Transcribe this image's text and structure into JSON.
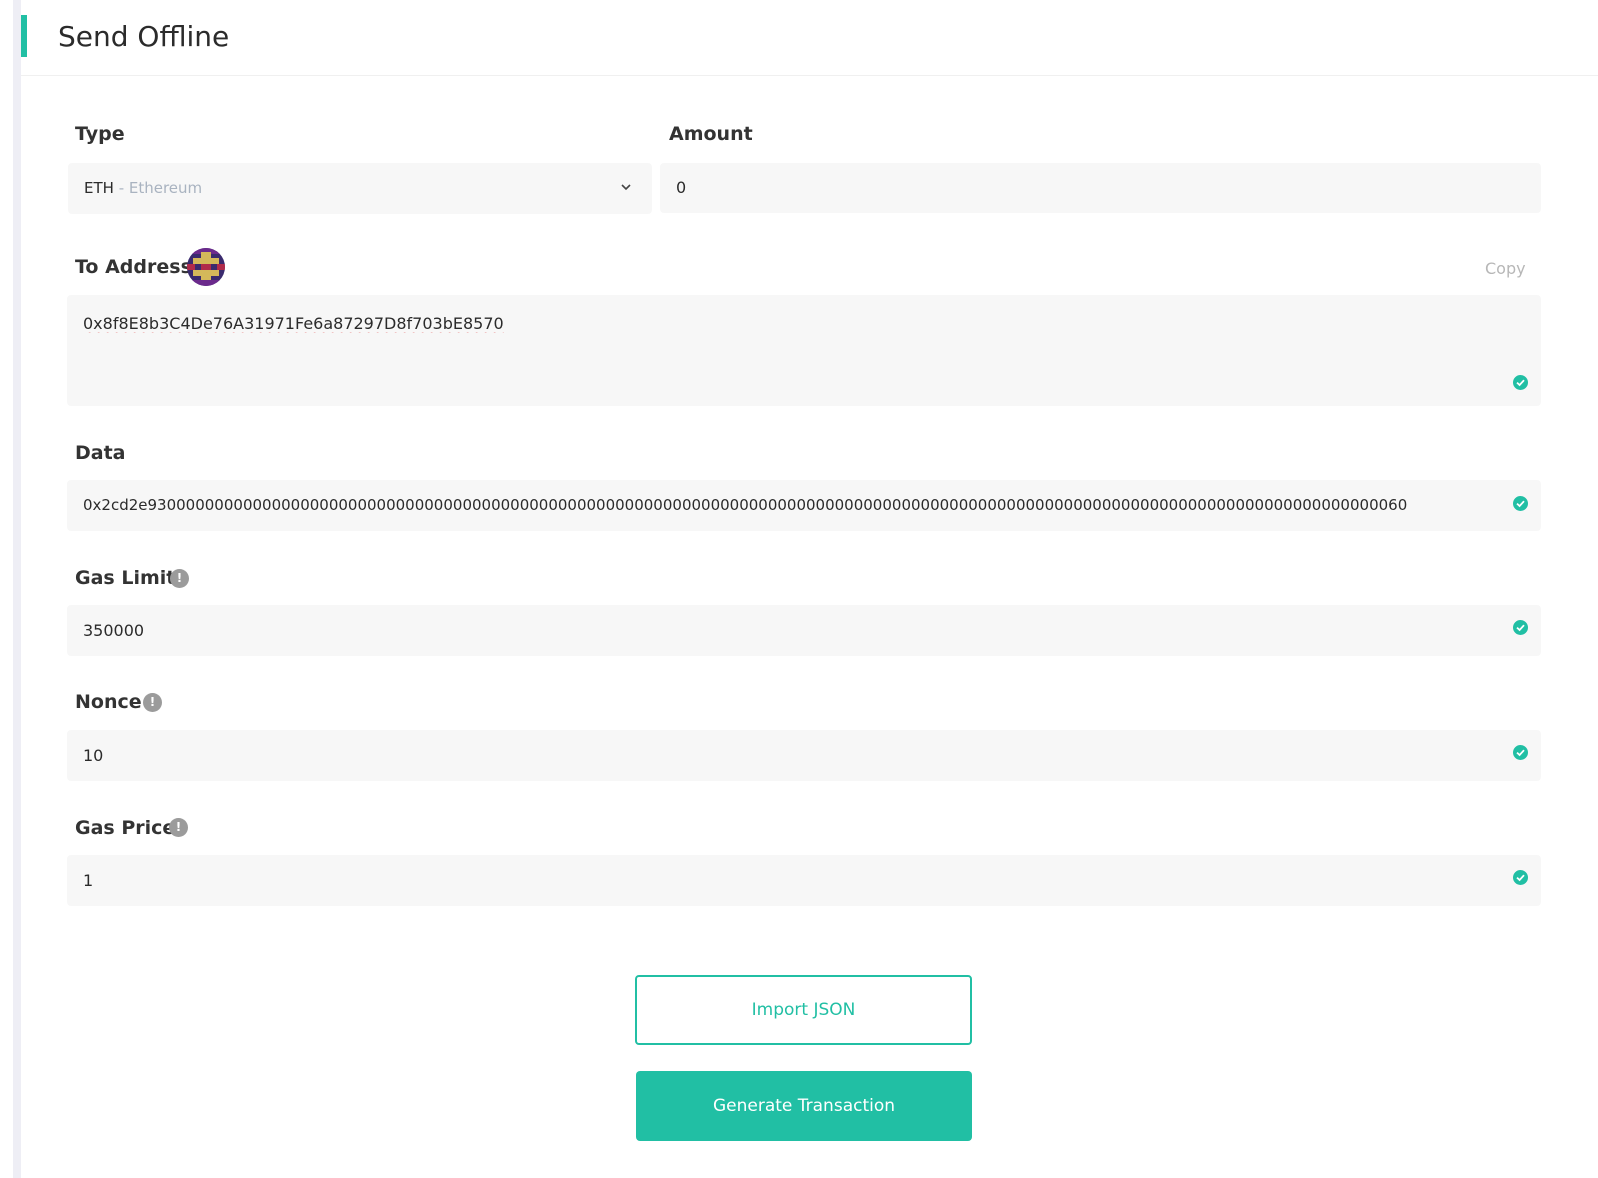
{
  "header": {
    "title": "Send Offline"
  },
  "type_field": {
    "label": "Type",
    "symbol": "ETH",
    "name": " - Ethereum"
  },
  "amount_field": {
    "label": "Amount",
    "value": "0"
  },
  "to_address": {
    "label": "To Address",
    "copy_label": "Copy",
    "value": "0x8f8E8b3C4De76A31971Fe6a87297D8f703bE8570"
  },
  "data_field": {
    "label": "Data",
    "value": "0x2cd2e930000000000000000000000000000000000000000000000000000000000000000000000000000000000000000000000000000000000000000000000000000000060"
  },
  "gas_limit": {
    "label": "Gas Limit",
    "value": "350000"
  },
  "nonce": {
    "label": "Nonce",
    "value": "10"
  },
  "gas_price": {
    "label": "Gas Price",
    "value": "1"
  },
  "buttons": {
    "import_json": "Import JSON",
    "generate": "Generate Transaction"
  },
  "colors": {
    "accent": "#21bfa4",
    "field_bg": "#f7f7f7",
    "info_icon": "#9b9b9b"
  },
  "icons": {
    "info": "info-icon",
    "check": "check-circle-icon",
    "chevron": "chevron-down-icon",
    "identicon": "address-identicon"
  }
}
